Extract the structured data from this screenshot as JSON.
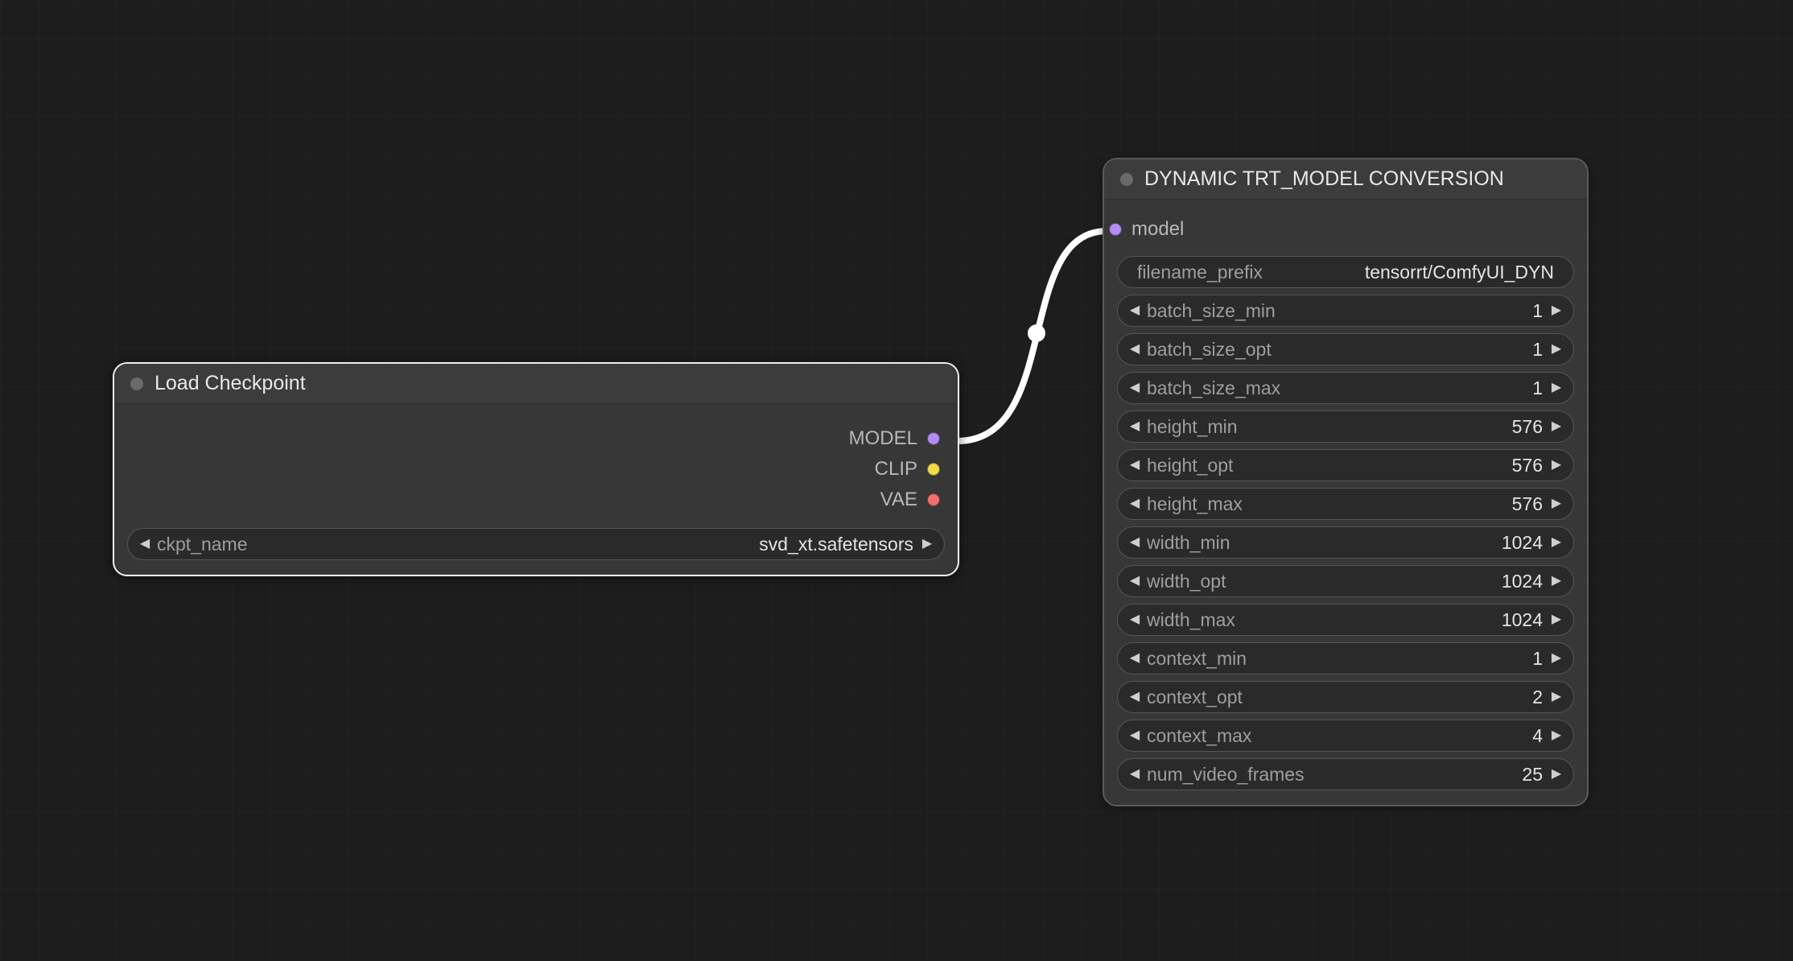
{
  "nodes": {
    "load_checkpoint": {
      "title": "Load Checkpoint",
      "outputs": {
        "model": "MODEL",
        "clip": "CLIP",
        "vae": "VAE"
      },
      "widgets": {
        "ckpt_name": {
          "label": "ckpt_name",
          "value": "svd_xt.safetensors"
        }
      }
    },
    "dynamic_trt": {
      "title": "DYNAMIC TRT_MODEL CONVERSION",
      "inputs": {
        "model": "model"
      },
      "widgets": {
        "filename_prefix": {
          "label": "filename_prefix",
          "value": "tensorrt/ComfyUI_DYN"
        },
        "batch_size_min": {
          "label": "batch_size_min",
          "value": "1"
        },
        "batch_size_opt": {
          "label": "batch_size_opt",
          "value": "1"
        },
        "batch_size_max": {
          "label": "batch_size_max",
          "value": "1"
        },
        "height_min": {
          "label": "height_min",
          "value": "576"
        },
        "height_opt": {
          "label": "height_opt",
          "value": "576"
        },
        "height_max": {
          "label": "height_max",
          "value": "576"
        },
        "width_min": {
          "label": "width_min",
          "value": "1024"
        },
        "width_opt": {
          "label": "width_opt",
          "value": "1024"
        },
        "width_max": {
          "label": "width_max",
          "value": "1024"
        },
        "context_min": {
          "label": "context_min",
          "value": "1"
        },
        "context_opt": {
          "label": "context_opt",
          "value": "2"
        },
        "context_max": {
          "label": "context_max",
          "value": "4"
        },
        "num_video_frames": {
          "label": "num_video_frames",
          "value": "25"
        }
      }
    }
  },
  "colors": {
    "port_model": "#b48bf2",
    "port_clip": "#f2d94a",
    "port_vae": "#f26f6f",
    "link": "#ffffff"
  }
}
